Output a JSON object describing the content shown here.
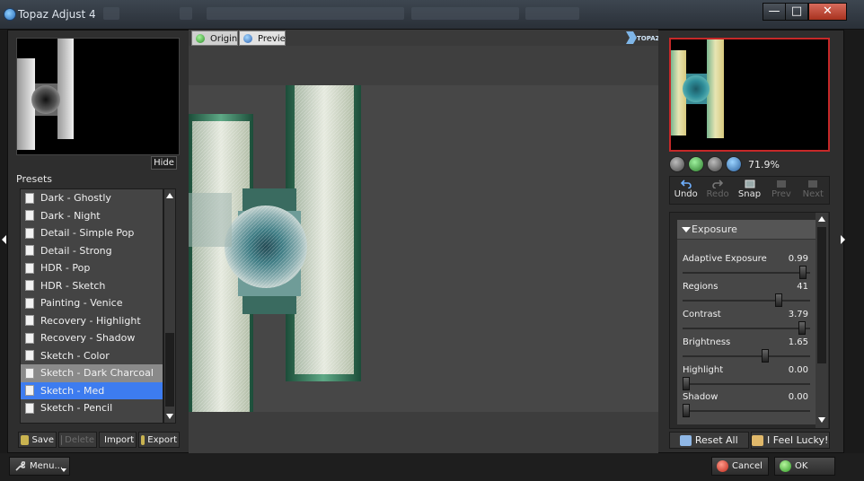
{
  "window": {
    "title": "Topaz Adjust 4"
  },
  "left": {
    "hide_label": "Hide",
    "presets_label": "Presets",
    "presets": [
      "Dark - Ghostly",
      "Dark - Night",
      "Detail - Simple Pop",
      "Detail - Strong",
      "HDR - Pop",
      "HDR - Sketch",
      "Painting - Venice",
      "Recovery - Highlight",
      "Recovery - Shadow",
      "Sketch - Color",
      "Sketch - Dark Charcoal",
      "Sketch - Med",
      "Sketch - Pencil"
    ],
    "hover_index": 10,
    "selected_index": 11,
    "actions": {
      "save": "Save",
      "delete": "Delete",
      "import": "Import",
      "export": "Export"
    }
  },
  "center": {
    "tab_original": "Original",
    "tab_preview": "Preview",
    "logo_text": "TOPAZ"
  },
  "right": {
    "zoom_value": "71.9%",
    "history": {
      "undo": "Undo",
      "redo": "Redo",
      "snap": "Snap",
      "prev": "Prev",
      "next": "Next"
    },
    "section_title": "Exposure",
    "sliders": [
      {
        "label": "Adaptive Exposure",
        "value": "0.99",
        "fraction": 0.97
      },
      {
        "label": "Regions",
        "value": "41",
        "fraction": 0.77
      },
      {
        "label": "Contrast",
        "value": "3.79",
        "fraction": 0.96
      },
      {
        "label": "Brightness",
        "value": "1.65",
        "fraction": 0.66
      },
      {
        "label": "Highlight",
        "value": "0.00",
        "fraction": 0.0
      },
      {
        "label": "Shadow",
        "value": "0.00",
        "fraction": 0.0
      }
    ],
    "reset_all": "Reset All",
    "feel_lucky": "I Feel Lucky!"
  },
  "bottom": {
    "menu": "Menu...",
    "cancel": "Cancel",
    "ok": "OK"
  },
  "colors": {
    "selection": "#3d7cf0",
    "nav_border": "#c62828",
    "panel": "#2e2e2e"
  }
}
